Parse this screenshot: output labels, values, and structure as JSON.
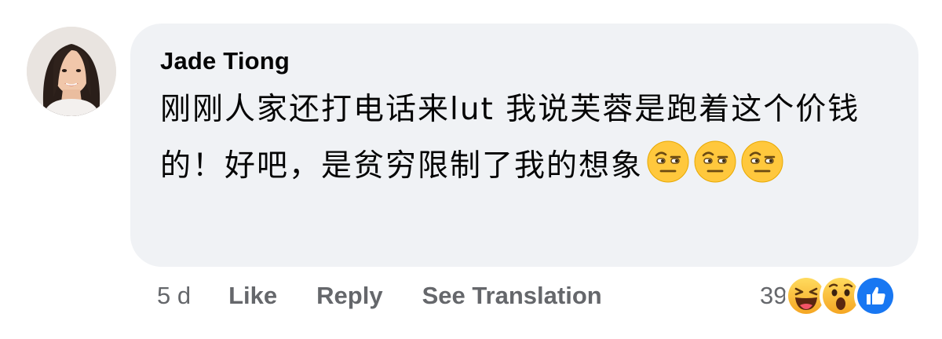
{
  "comment": {
    "author": "Jade Tiong",
    "text": "刚刚人家还打电话来lut 我说芙蓉是跑着这个价钱的！好吧，是贫穷限制了我的想象",
    "emojis": [
      "face-with-raised-eyebrow-icon",
      "face-with-raised-eyebrow-icon",
      "face-with-raised-eyebrow-icon"
    ]
  },
  "actions": {
    "time": "5 d",
    "like_label": "Like",
    "reply_label": "Reply",
    "translate_label": "See Translation"
  },
  "reactions": {
    "count": "39",
    "icons": [
      "haha-icon",
      "wow-icon",
      "like-icon"
    ]
  },
  "colors": {
    "bubble": "#f0f2f5",
    "secondary_text": "#65676b",
    "like_blue": "#1877f2",
    "emoji_yellow": "#ffc83d"
  }
}
